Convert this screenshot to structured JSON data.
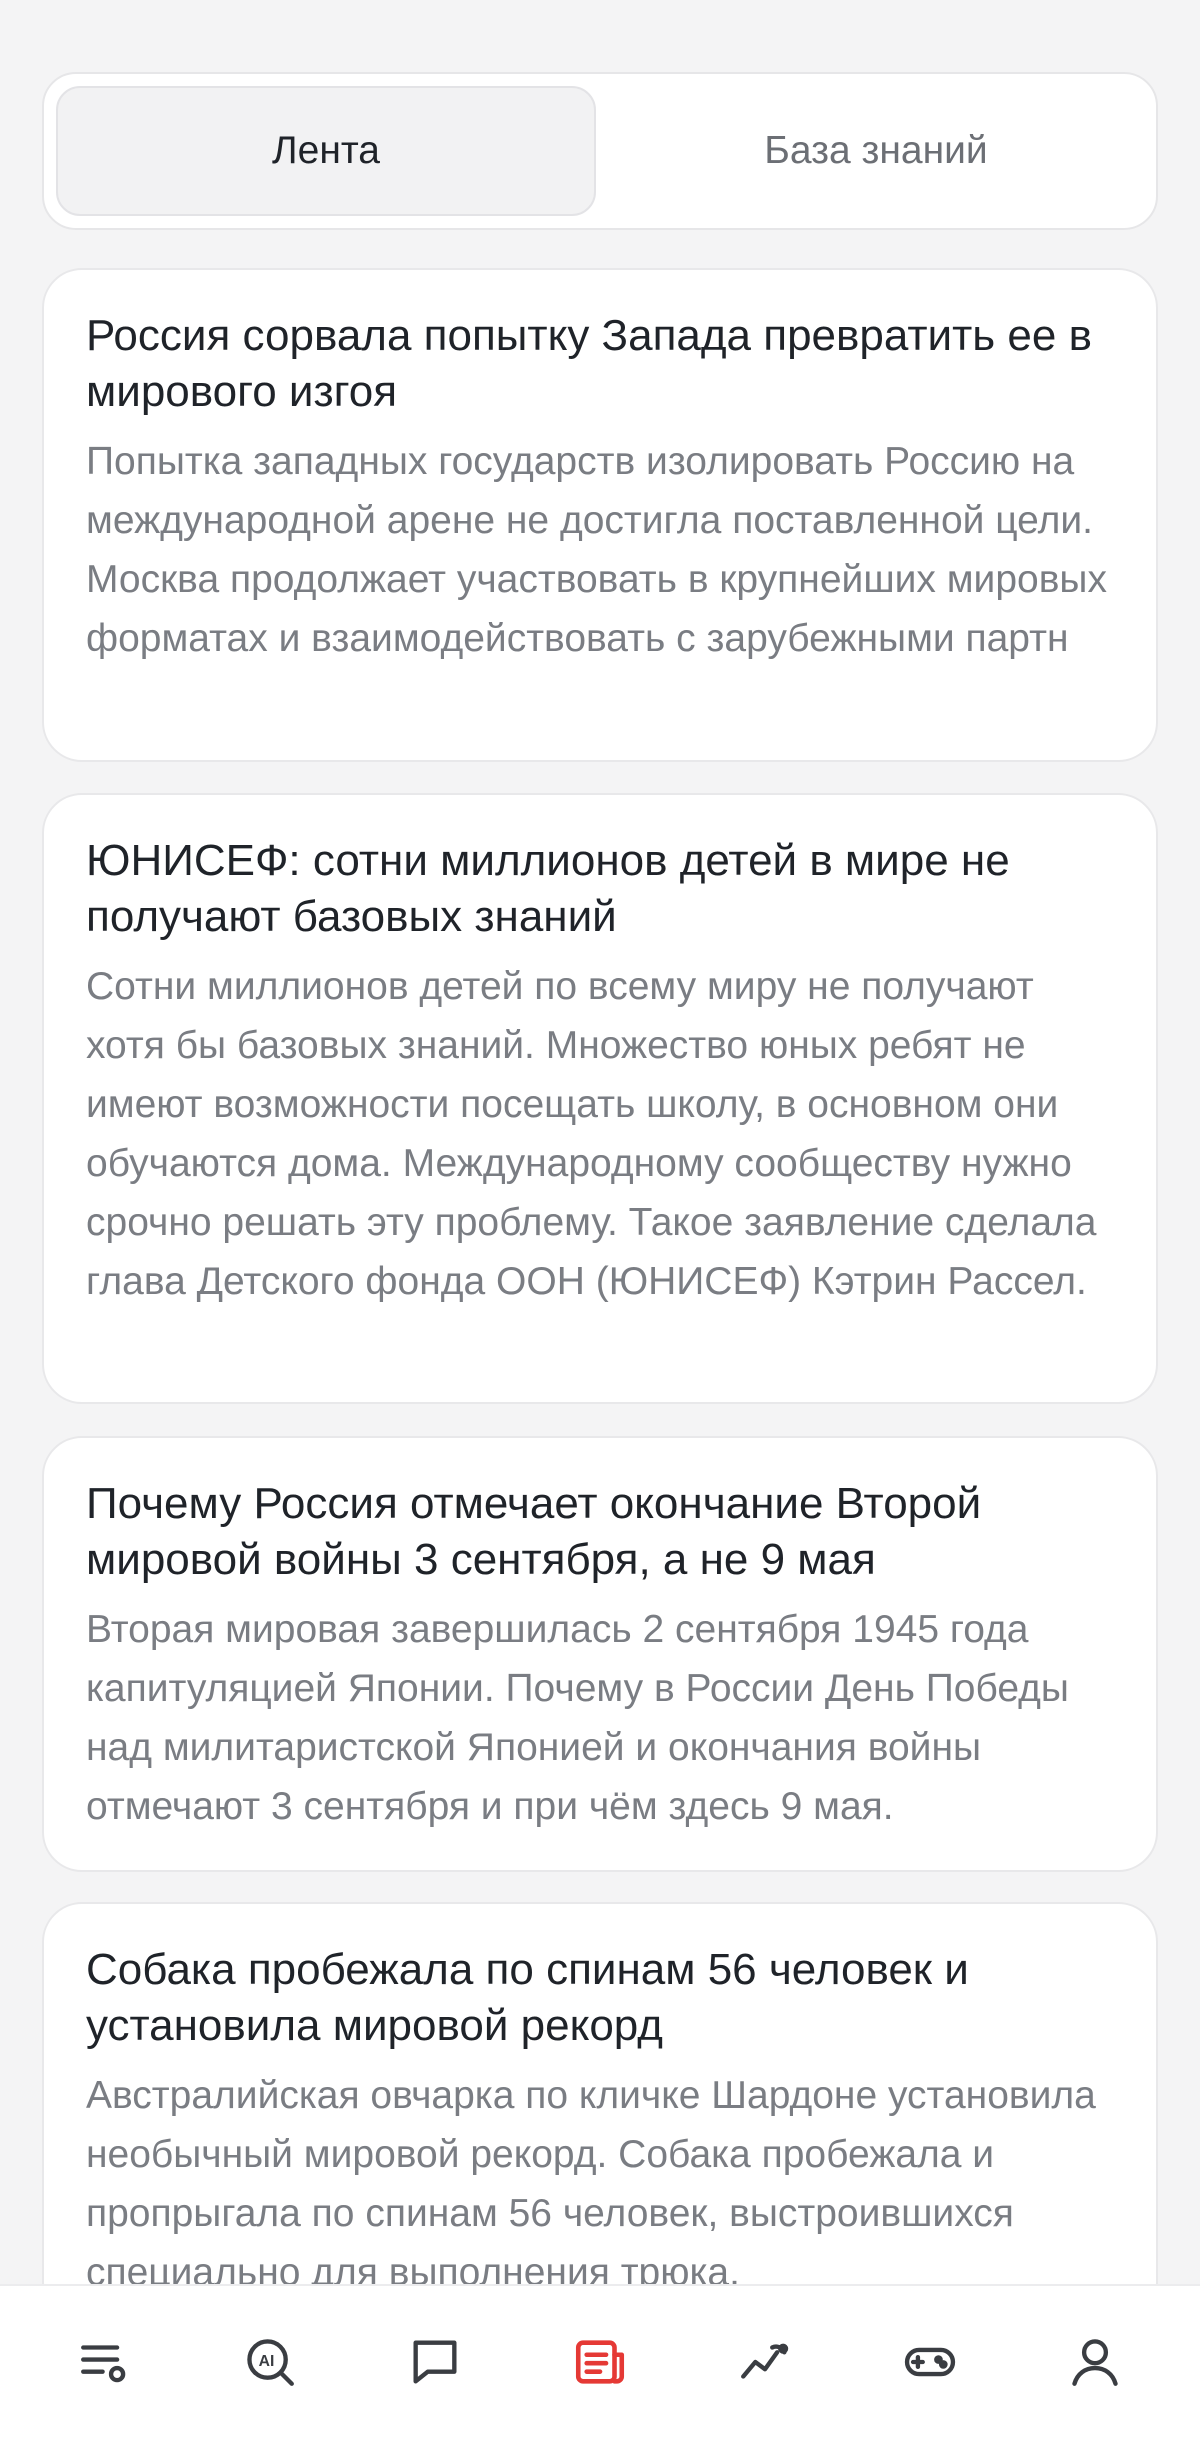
{
  "tabs": [
    {
      "label": "Лента",
      "active": true
    },
    {
      "label": "База знаний",
      "active": false
    }
  ],
  "feed": [
    {
      "title": "Россия сорвала попытку Запада превратить ее в мирового изгоя",
      "text": "Попытка западных государств изолировать Россию на международной арене не достигла поставленной цели. Москва продолжает участвовать в крупнейших мировых форматах и взаимодействовать с зарубежными партн"
    },
    {
      "title": "ЮНИСЕФ: сотни миллионов детей в мире не получают базовых знаний",
      "text": "Сотни миллионов детей по всему миру не получают хотя бы базовых знаний. Множество юных ребят не имеют возможности посещать школу, в основном они обучаются дома. Международному сообществу нужно срочно решать эту проблему. Такое заявление сделала глава Детского фонда ООН (ЮНИСЕФ) Кэтрин Рассел."
    },
    {
      "title": "Почему Россия отмечает окончание Второй мировой войны 3 сентября, а не 9 мая",
      "text": "Вторая мировая завершилась 2 сентября 1945 года капитуляцией Японии. Почему в России День Победы над милитаристской Японией и окончания войны отмечают 3 сентября и при чём здесь 9 мая."
    },
    {
      "title": "Собака пробежала по спинам 56 человек и установила мировой рекорд",
      "text": "Австралийская овчарка по кличке Шардоне установила необычный мировой рекорд. Собака пробежала и пропрыгала по спинам 56 человек, выстроившихся специально для выполнения трюка."
    }
  ],
  "bottom_nav": [
    {
      "icon": "playlist-icon",
      "active": false
    },
    {
      "icon": "ai-search-icon",
      "active": false
    },
    {
      "icon": "chat-icon",
      "active": false
    },
    {
      "icon": "news-icon",
      "active": true
    },
    {
      "icon": "trend-icon",
      "active": false
    },
    {
      "icon": "gamepad-icon",
      "active": false
    },
    {
      "icon": "profile-icon",
      "active": false
    }
  ],
  "colors": {
    "accent": "#e53935",
    "icon": "#3a3d42",
    "background": "#f4f4f5"
  }
}
